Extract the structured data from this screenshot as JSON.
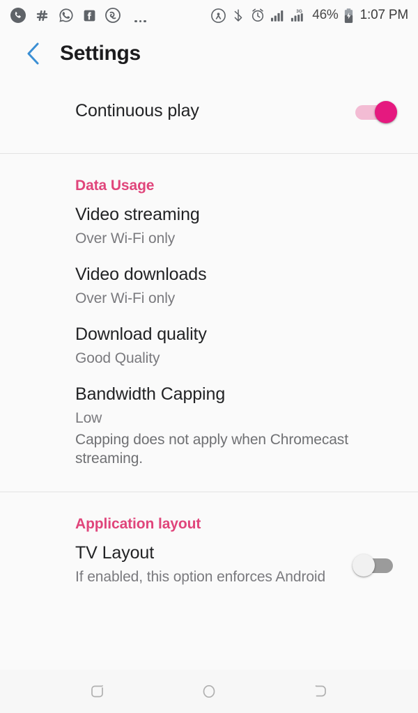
{
  "status_bar": {
    "notification_icons": [
      {
        "name": "missed-call-icon",
        "label": "Phone"
      },
      {
        "name": "slack-icon",
        "label": "Slack"
      },
      {
        "name": "whatsapp-icon",
        "label": "WhatsApp"
      },
      {
        "name": "facebook-icon",
        "label": "Facebook"
      },
      {
        "name": "app-notification-icon",
        "label": "App"
      }
    ],
    "overflow_indicator": "…",
    "system_icons": [
      {
        "name": "hotspot-icon",
        "label": "Hotspot"
      },
      {
        "name": "bluetooth-icon",
        "label": "Bluetooth"
      },
      {
        "name": "alarm-icon",
        "label": "Alarm"
      },
      {
        "name": "signal-bars-icon",
        "label": "Signal"
      },
      {
        "name": "signal-3g-icon",
        "label": "3G"
      }
    ],
    "network_type": "3G",
    "battery_percent": "46%",
    "battery_state": "charging",
    "time": "1:07 PM"
  },
  "app_bar": {
    "back_label": "‹",
    "title": "Settings",
    "back_color": "#3b8fd4"
  },
  "colors": {
    "accent_pink": "#e0457b",
    "toggle_on": "#e5197f",
    "toggle_on_track": "#f3bcd4",
    "toggle_off_track": "#9b9b9b",
    "background": "#fafafa"
  },
  "top_setting": {
    "title": "Continuous play",
    "toggle_state": "on"
  },
  "sections": [
    {
      "header": "Data Usage",
      "items": [
        {
          "title": "Video streaming",
          "subtitle": "Over Wi-Fi only"
        },
        {
          "title": "Video downloads",
          "subtitle": "Over Wi-Fi only"
        },
        {
          "title": "Download quality",
          "subtitle": "Good Quality"
        },
        {
          "title": "Bandwidth Capping",
          "subtitle": "Low"
        }
      ],
      "note": "Capping does not apply when Chromecast streaming."
    },
    {
      "header": "Application layout",
      "items": [
        {
          "title": "TV Layout",
          "subtitle": "If enabled, this option enforces Android",
          "toggle_state": "off"
        }
      ]
    }
  ],
  "nav_bar": {
    "buttons": [
      {
        "name": "recents-button",
        "label": "Recents"
      },
      {
        "name": "home-button",
        "label": "Home"
      },
      {
        "name": "back-button",
        "label": "Back"
      }
    ]
  }
}
